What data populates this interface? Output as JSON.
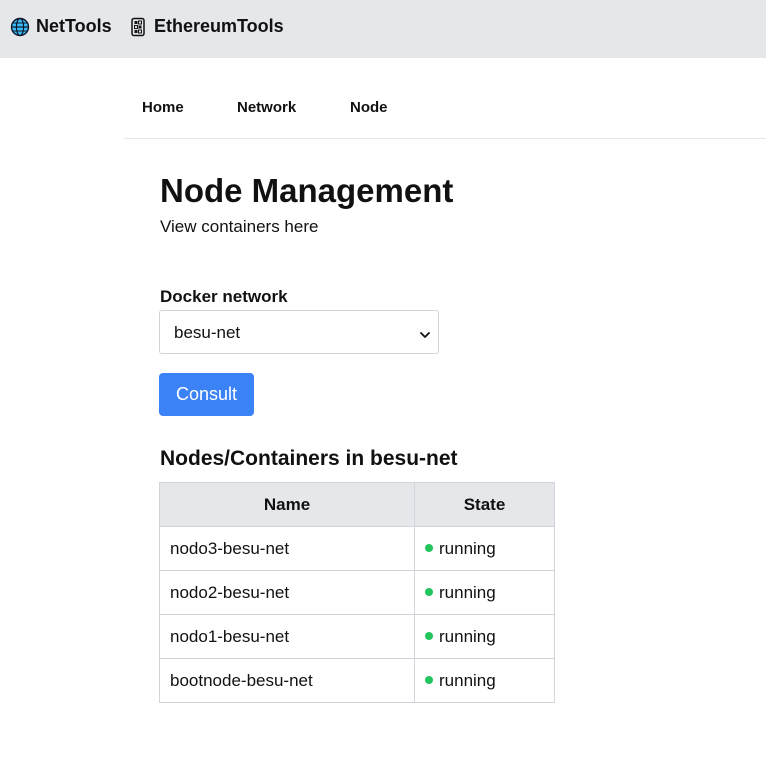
{
  "header": {
    "brands": [
      {
        "label": "NetTools",
        "icon": "globe-icon"
      },
      {
        "label": "EthereumTools",
        "icon": "chain-icon"
      }
    ]
  },
  "nav": {
    "tabs": [
      {
        "label": "Home"
      },
      {
        "label": "Network"
      },
      {
        "label": "Node"
      }
    ]
  },
  "page": {
    "title": "Node Management",
    "subtitle": "View containers here"
  },
  "form": {
    "network_label": "Docker network",
    "network_value": "besu-net",
    "consult_label": "Consult"
  },
  "results": {
    "title": "Nodes/Containers in besu-net",
    "columns": [
      "Name",
      "State"
    ],
    "rows": [
      {
        "name": "nodo3-besu-net",
        "state": "running"
      },
      {
        "name": "nodo2-besu-net",
        "state": "running"
      },
      {
        "name": "nodo1-besu-net",
        "state": "running"
      },
      {
        "name": "bootnode-besu-net",
        "state": "running"
      }
    ]
  },
  "colors": {
    "accent": "#3b82f6",
    "status_running": "#22c55e",
    "header_bg": "#e5e7eb"
  }
}
